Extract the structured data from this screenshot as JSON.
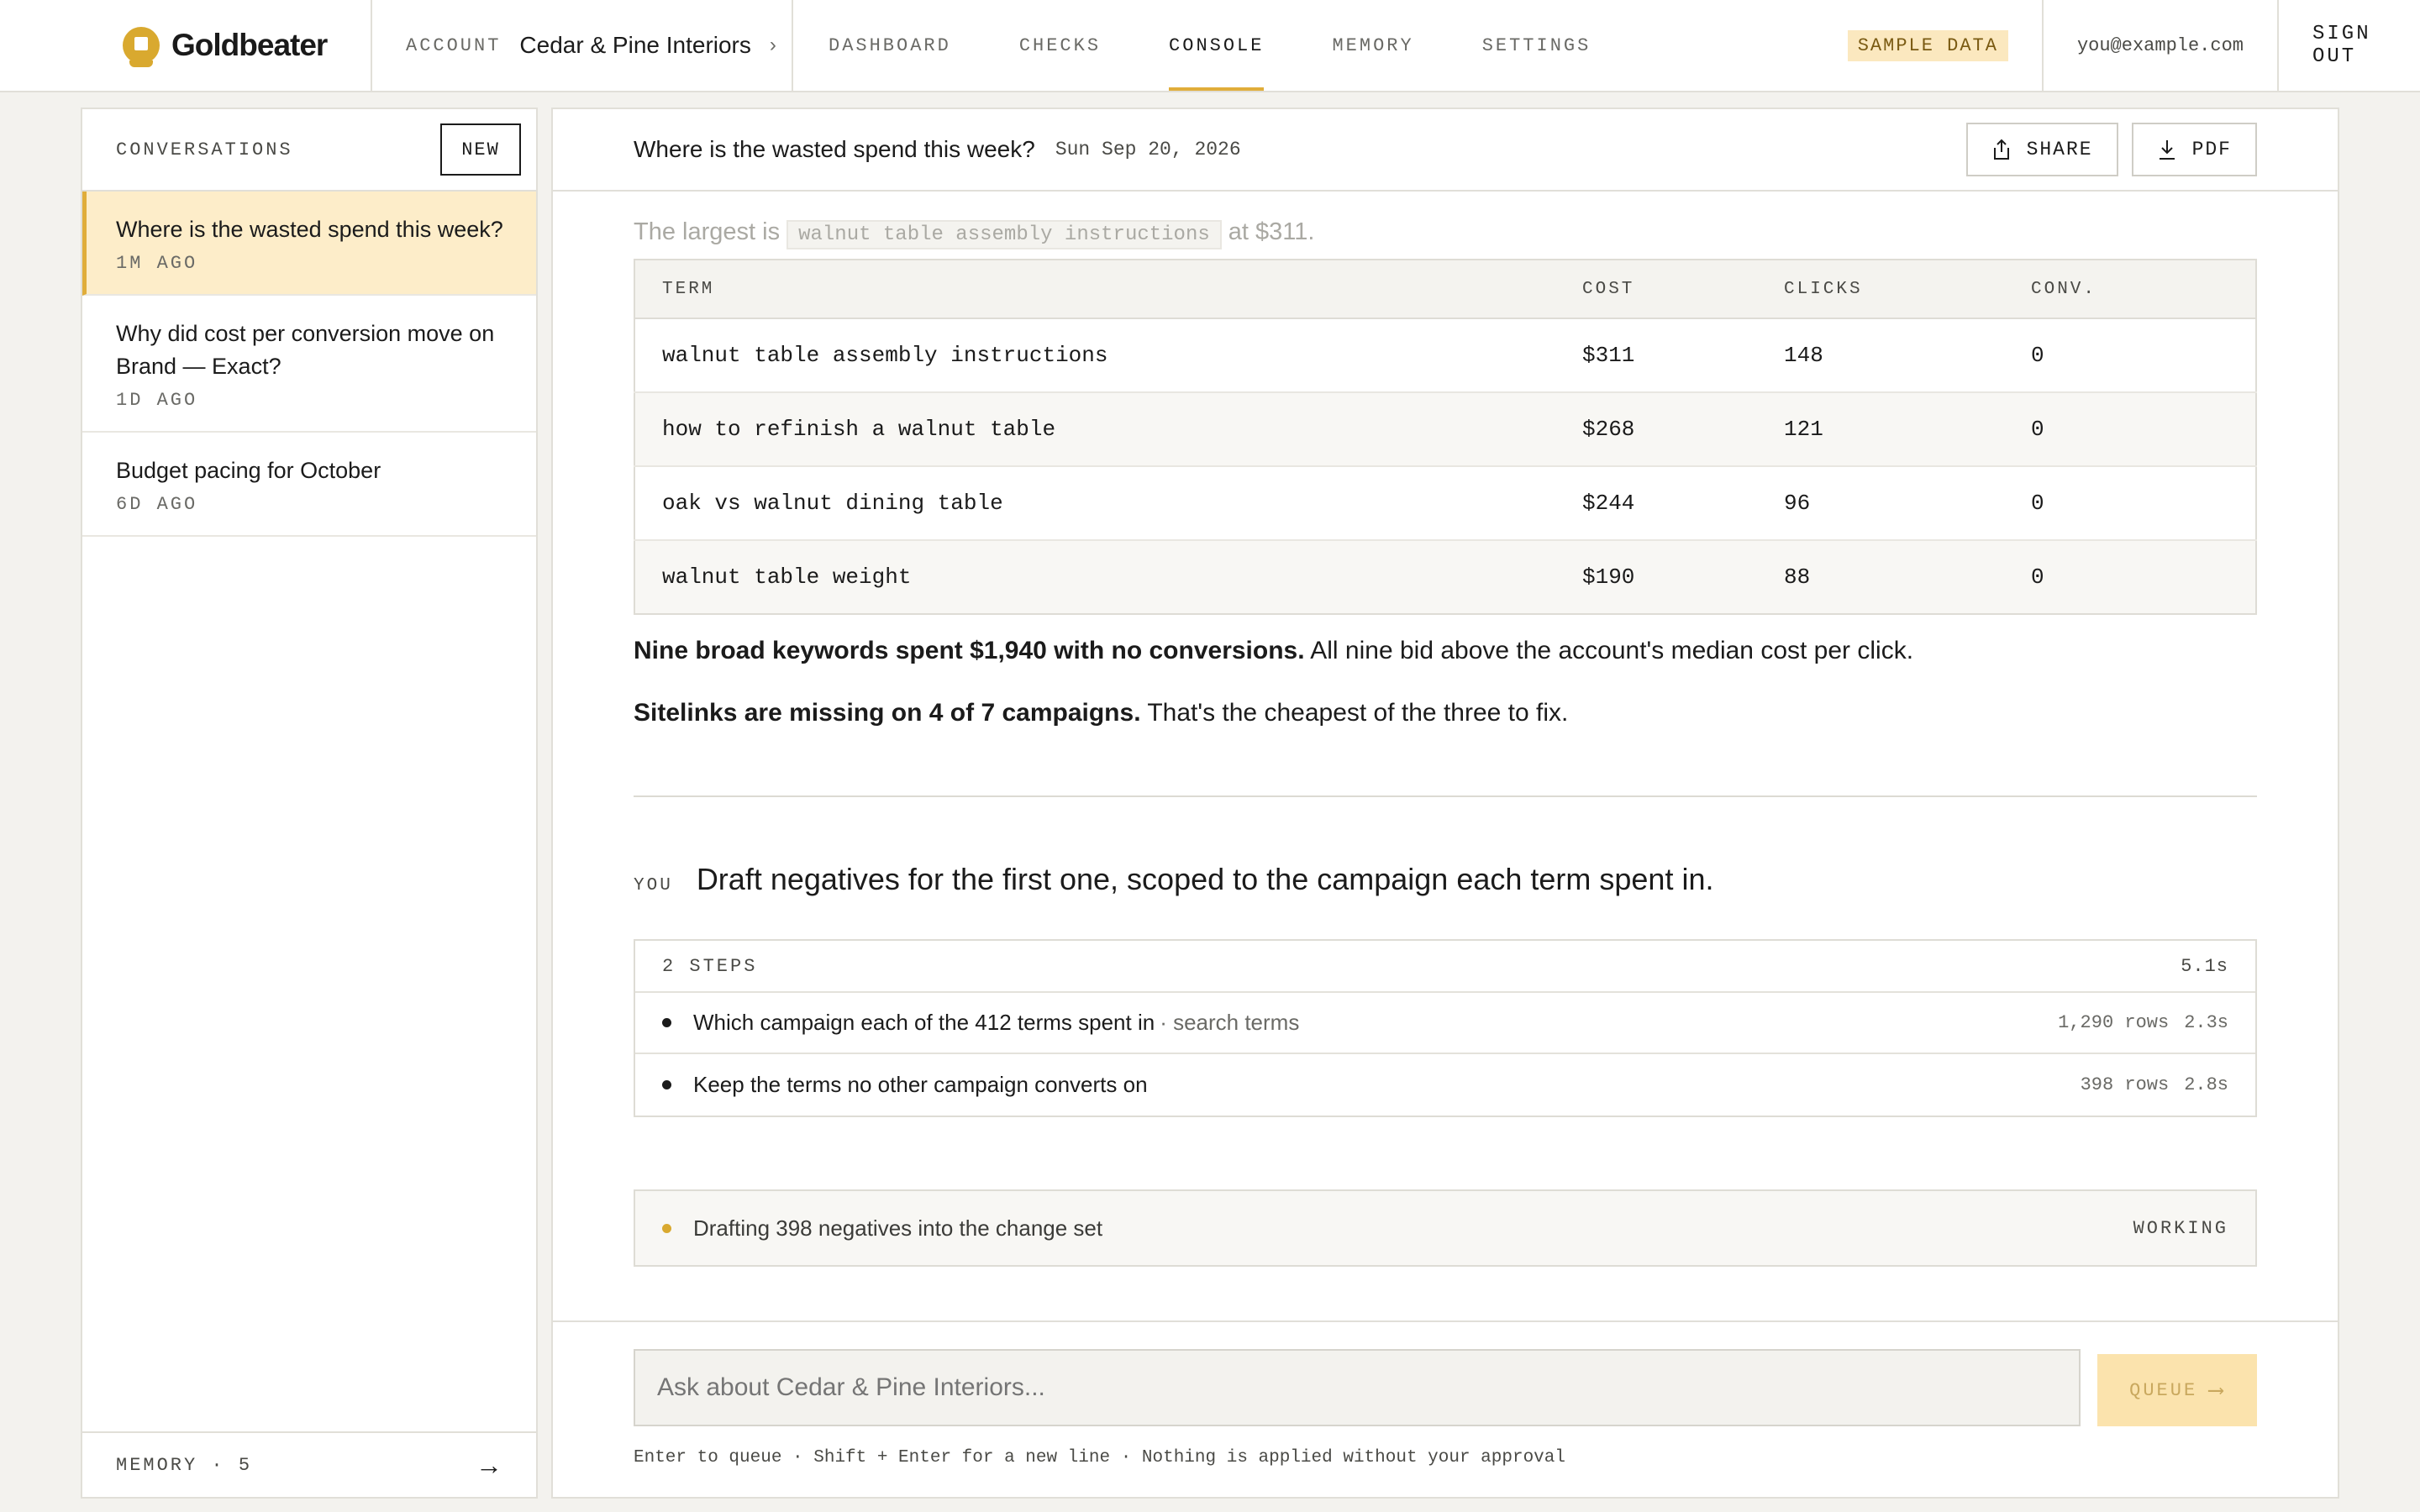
{
  "brand": {
    "name": "Goldbeater"
  },
  "account": {
    "label": "ACCOUNT",
    "name": "Cedar & Pine Interiors",
    "chevron": "›"
  },
  "nav": {
    "items": [
      {
        "label": "DASHBOARD"
      },
      {
        "label": "CHECKS"
      },
      {
        "label": "CONSOLE"
      },
      {
        "label": "MEMORY"
      },
      {
        "label": "SETTINGS"
      }
    ],
    "active": "CONSOLE"
  },
  "topbar": {
    "badge": "SAMPLE DATA",
    "email": "you@example.com",
    "signout": "SIGN OUT"
  },
  "sidebar": {
    "title": "CONVERSATIONS",
    "new_label": "NEW",
    "conversations": [
      {
        "title": "Where is the wasted spend this week?",
        "time": "1M AGO"
      },
      {
        "title": "Why did cost per conversion move on Brand — Exact?",
        "time": "1D AGO"
      },
      {
        "title": "Budget pacing for October",
        "time": "6D AGO"
      }
    ],
    "footer": "MEMORY · 5",
    "footer_arrow": "→"
  },
  "main": {
    "title": "Where is the wasted spend this week?",
    "date": "Sun Sep 20, 2026",
    "share_label": "SHARE",
    "pdf_label": "PDF",
    "faded_prefix": "The largest is",
    "faded_term": "walnut table assembly instructions",
    "faded_suffix": "at $311.",
    "table": {
      "headers": [
        "TERM",
        "COST",
        "CLICKS",
        "CONV."
      ],
      "rows": [
        [
          "walnut table assembly instructions",
          "$311",
          "148",
          "0"
        ],
        [
          "how to refinish a walnut table",
          "$268",
          "121",
          "0"
        ],
        [
          "oak vs walnut dining table",
          "$244",
          "96",
          "0"
        ],
        [
          "walnut table weight",
          "$190",
          "88",
          "0"
        ]
      ]
    },
    "finding1_bold": "Nine broad keywords spent $1,940 with no conversions.",
    "finding1_rest": " All nine bid above the account's median cost per click.",
    "finding2_bold": "Sitelinks are missing on 4 of 7 campaigns.",
    "finding2_rest": " That's the cheapest of the three to fix.",
    "you_label": "YOU",
    "you_text": "Draft negatives for the first one, scoped to the campaign each term spent in.",
    "steps": {
      "count_label": "2 STEPS",
      "total": "5.1s",
      "items": [
        {
          "text": "Which campaign each of the 412 terms spent in",
          "source": "· search terms",
          "rows": "1,290 rows",
          "time": "2.3s"
        },
        {
          "text": "Keep the terms no other campaign converts on",
          "source": "",
          "rows": "398 rows",
          "time": "2.8s"
        }
      ]
    },
    "working": {
      "text": "Drafting 398 negatives into the change set",
      "status": "WORKING"
    },
    "composer": {
      "placeholder": "Ask about Cedar & Pine Interiors...",
      "queue_label": "QUEUE",
      "queue_arrow": "⟶",
      "hint": "Enter to queue · Shift + Enter for a new line · Nothing is applied without your approval"
    }
  }
}
